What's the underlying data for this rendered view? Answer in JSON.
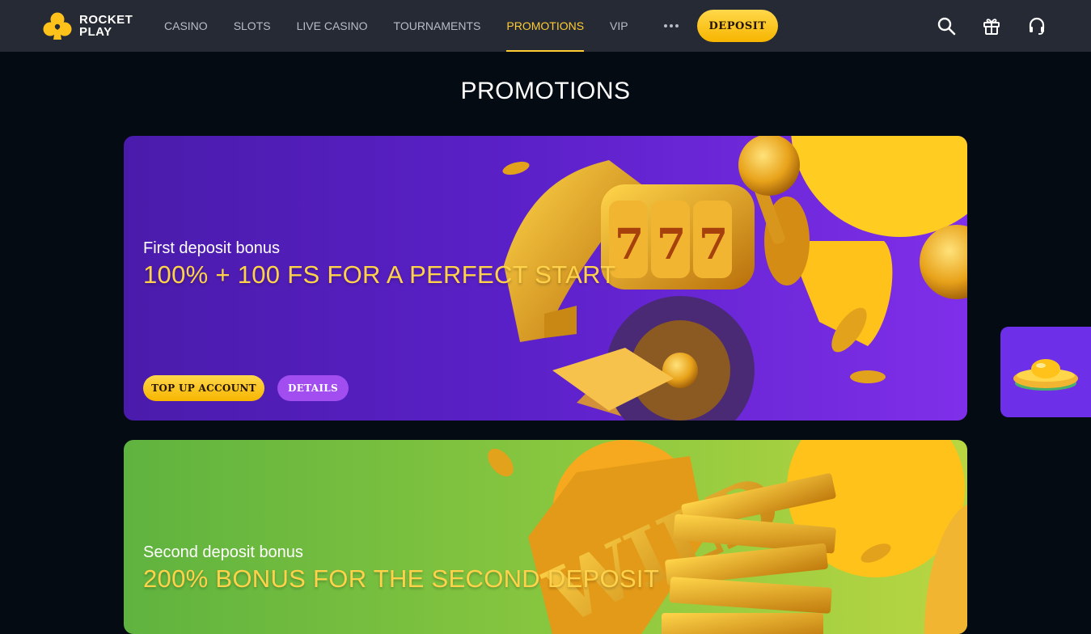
{
  "brand": {
    "line1": "ROCKET",
    "line2": "PLAY"
  },
  "nav": {
    "items": [
      {
        "label": "CASINO",
        "active": false
      },
      {
        "label": "SLOTS",
        "active": false
      },
      {
        "label": "LIVE CASINO",
        "active": false
      },
      {
        "label": "TOURNAMENTS",
        "active": false
      },
      {
        "label": "PROMOTIONS",
        "active": true
      },
      {
        "label": "VIP",
        "active": false
      }
    ],
    "more_icon": "ellipsis-icon"
  },
  "header": {
    "deposit_label": "DEPOSIT",
    "icons": [
      "search-icon",
      "gift-icon",
      "headset-icon"
    ]
  },
  "page": {
    "title": "PROMOTIONS"
  },
  "promotions": [
    {
      "subtitle": "First deposit bonus",
      "headline": "100% + 100 FS FOR A PERFECT START",
      "primary_button": "TOP UP ACCOUNT",
      "secondary_button": "DETAILS"
    },
    {
      "subtitle": "Second deposit bonus",
      "headline": "200% BONUS FOR THE SECOND DEPOSIT"
    }
  ],
  "colors": {
    "accent": "#ffcc33",
    "header_bg": "#262a35",
    "page_bg": "#040b12",
    "promo1_bg": "#5a20c7",
    "promo2_bg": "#8bc83f",
    "details_button": "#a14df0",
    "widget_bg": "#6d2fe8"
  }
}
